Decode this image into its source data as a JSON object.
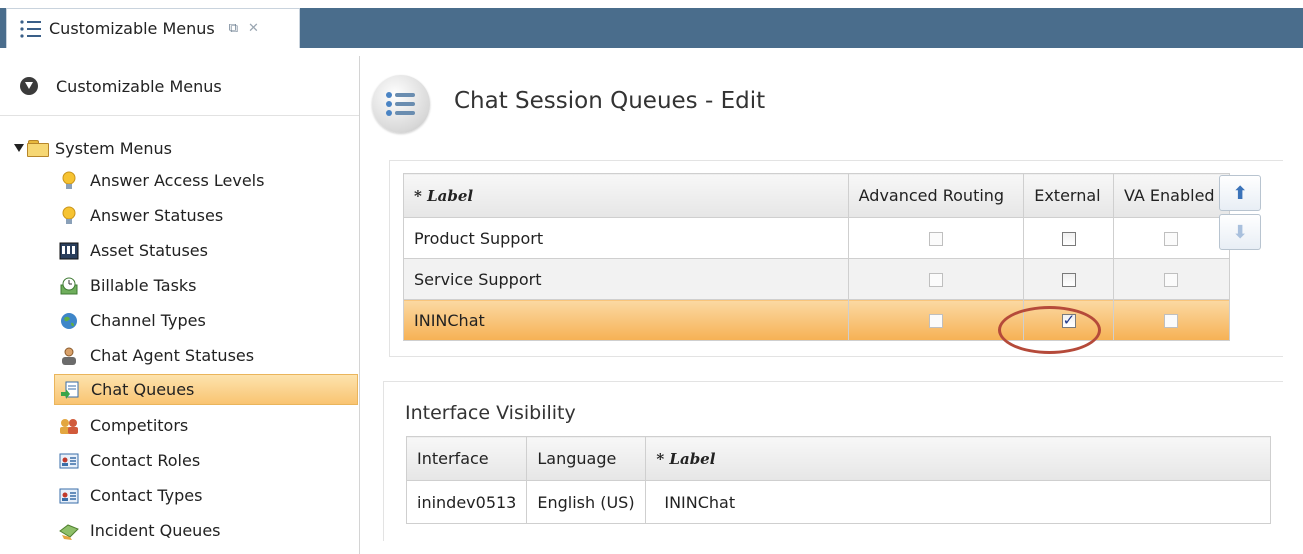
{
  "tab": {
    "title": "Customizable Menus",
    "restore_icon": "restore-icon",
    "close_icon": "close-icon"
  },
  "left": {
    "header": "Customizable Menus",
    "root": "System Menus",
    "items": [
      {
        "label": "Answer Access Levels",
        "icon": "lightbulb-icon"
      },
      {
        "label": "Answer Statuses",
        "icon": "lightbulb-icon"
      },
      {
        "label": "Asset Statuses",
        "icon": "counter-icon"
      },
      {
        "label": "Billable Tasks",
        "icon": "clock-icon"
      },
      {
        "label": "Channel Types",
        "icon": "globe-icon"
      },
      {
        "label": "Chat Agent Statuses",
        "icon": "person-icon"
      },
      {
        "label": "Chat Queues",
        "icon": "queue-icon"
      },
      {
        "label": "Competitors",
        "icon": "group-icon"
      },
      {
        "label": "Contact Roles",
        "icon": "contact-card-icon"
      },
      {
        "label": "Contact Types",
        "icon": "contact-card-icon"
      },
      {
        "label": "Incident Queues",
        "icon": "incident-queue-icon"
      }
    ],
    "selected": "Chat Queues"
  },
  "main": {
    "title": "Chat Session Queues - Edit",
    "queues": {
      "headers": [
        "* Label",
        "Advanced Routing",
        "External",
        "VA Enabled"
      ],
      "rows": [
        {
          "label": "Product Support",
          "advanced_routing": false,
          "external": false,
          "va_enabled": false
        },
        {
          "label": "Service Support",
          "advanced_routing": false,
          "external": false,
          "va_enabled": false
        },
        {
          "label": "ININChat",
          "advanced_routing": false,
          "external": true,
          "va_enabled": false
        }
      ],
      "selected_row": "ININChat"
    },
    "move_up_icon": "arrow-up-icon",
    "move_down_icon": "arrow-down-icon",
    "visibility": {
      "title": "Interface Visibility",
      "headers": [
        "Interface",
        "Language",
        "* Label"
      ],
      "rows": [
        {
          "interface": "inindev0513",
          "language": "English (US)",
          "label": "ININChat"
        }
      ]
    }
  },
  "colors": {
    "tabstrip": "#4a6d8c",
    "selection": "#f9c472",
    "highlight_ellipse": "#b54a3a"
  }
}
